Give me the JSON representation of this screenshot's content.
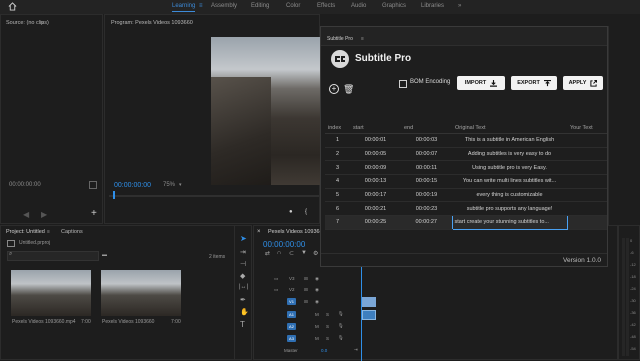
{
  "workspaces": {
    "items": [
      "Learning",
      "Assembly",
      "Editing",
      "Color",
      "Effects",
      "Audio",
      "Graphics",
      "Libraries"
    ],
    "active": "Learning"
  },
  "source_panel": {
    "title": "Source: (no clips)",
    "timecode": "00:00:00:00"
  },
  "program_panel": {
    "title": "Program: Pexels Videos 1093660",
    "timecode": "00:00:00:00",
    "zoom": "75%"
  },
  "project_panel": {
    "tab_project": "Project: Untitled",
    "tab_captions": "Captions",
    "file_name": "Untitled.prproj",
    "items_count": "2 items",
    "clips": [
      {
        "name": "Pexels Videos 1093660.mp4",
        "duration": "7:00"
      },
      {
        "name": "Pexels Videos 1093660",
        "duration": "7:00"
      }
    ]
  },
  "timeline_panel": {
    "sequence_name": "Pexels Videos 1093660",
    "timecode": "00:00:00:00",
    "video_tracks": [
      "V3",
      "V2",
      "V1"
    ],
    "audio_tracks": [
      "A1",
      "A2",
      "A3"
    ],
    "track_buttons": [
      "M",
      "S"
    ],
    "master_label": "Master",
    "master_value": "0.0"
  },
  "meter_scale": [
    "0",
    "-6",
    "-12",
    "-18",
    "-24",
    "-30",
    "-36",
    "-42",
    "-48",
    "-54"
  ],
  "plugin": {
    "window_title": "Subtitle Pro",
    "header_title": "Subtitle Pro",
    "bom_label": "BOM Encoding",
    "bom_checked": false,
    "import_label": "IMPORT",
    "export_label": "EXPORT",
    "apply_label": "APPLY",
    "columns": [
      "index",
      "start",
      "end",
      "Original Text",
      "Your Text"
    ],
    "rows": [
      {
        "index": "1",
        "start": "00:00:01",
        "end": "00:00:03",
        "original": "This is a subtitle in American English",
        "yours": ""
      },
      {
        "index": "2",
        "start": "00:00:05",
        "end": "00:00:07",
        "original": "Adding subtitles is very easy to do",
        "yours": ""
      },
      {
        "index": "3",
        "start": "00:00:09",
        "end": "00:00:11",
        "original": "Using subtitle pro is very Easy.",
        "yours": ""
      },
      {
        "index": "4",
        "start": "00:00:13",
        "end": "00:00:15",
        "original": "You can write multi lines subtitles wit...",
        "yours": ""
      },
      {
        "index": "5",
        "start": "00:00:17",
        "end": "00:00:19",
        "original": "every thing is customizable",
        "yours": ""
      },
      {
        "index": "6",
        "start": "00:00:21",
        "end": "00:00:23",
        "original": "subtitle pro supports any language!",
        "yours": ""
      },
      {
        "index": "7",
        "start": "00:00:25",
        "end": "00:00:27",
        "original": "start create your stunning subtitles to...",
        "yours": ""
      }
    ],
    "selected_row_index": "7",
    "version": "Version 1.0.0"
  },
  "colors": {
    "accent_blue": "#2f8fe8",
    "clip_blue": "#7aa6d6",
    "background": "#1d1d1d"
  }
}
